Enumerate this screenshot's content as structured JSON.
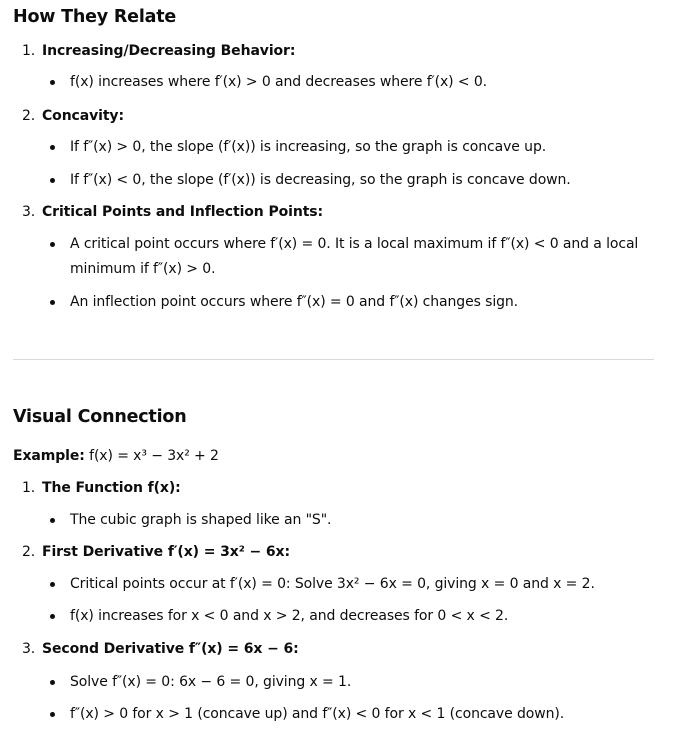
{
  "relate": {
    "title": "How They Relate",
    "item1": {
      "num": "1.",
      "title": "Increasing/Decreasing Behavior:",
      "b1": "f(x) increases where f′(x) > 0 and decreases where f′(x) < 0."
    },
    "item2": {
      "num": "2.",
      "title": "Concavity:",
      "b1": "If f″(x) > 0, the slope (f′(x)) is increasing, so the graph is concave up.",
      "b2": "If f″(x) < 0, the slope (f′(x)) is decreasing, so the graph is concave down."
    },
    "item3": {
      "num": "3.",
      "title": "Critical Points and Inflection Points:",
      "b1_line1": "A critical point occurs where f′(x) = 0. It is a local maximum if f″(x) < 0 and a local",
      "b1_line2": "minimum if f″(x) > 0.",
      "b2": "An inflection point occurs where f″(x) = 0 and f″(x) changes sign."
    }
  },
  "visual": {
    "title": "Visual Connection",
    "example_label": "Example:",
    "example_expr": "f(x) = x³ − 3x² + 2",
    "item1": {
      "num": "1.",
      "title": "The Function f(x):",
      "b1": "The cubic graph is shaped like an \"S\"."
    },
    "item2": {
      "num": "2.",
      "title": "First Derivative f′(x) = 3x² − 6x:",
      "b1": "Critical points occur at f′(x) = 0: Solve 3x² − 6x = 0, giving x = 0 and x = 2.",
      "b2": "f(x) increases for x < 0 and x > 2, and decreases for 0 < x < 2."
    },
    "item3": {
      "num": "3.",
      "title": "Second Derivative f″(x) = 6x − 6:",
      "b1": "Solve f″(x) = 0: 6x − 6 = 0, giving x = 1.",
      "b2": "f″(x) > 0 for x > 1 (concave up) and f″(x) < 0 for x < 1 (concave down)."
    }
  }
}
